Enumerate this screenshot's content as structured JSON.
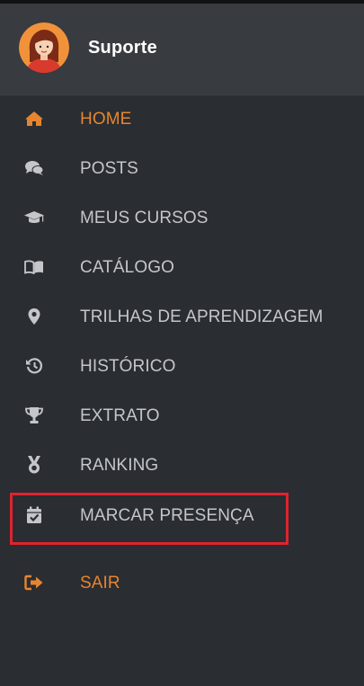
{
  "colors": {
    "background": "#2a2d31",
    "header_background": "#383b40",
    "accent": "#e68531",
    "text": "#c4c6ca",
    "icon": "#c4c6ca",
    "highlight_border": "#e0232e"
  },
  "user": {
    "name": "Suporte",
    "avatar_icon": "user-avatar-woman"
  },
  "menu": {
    "items": [
      {
        "label": "HOME",
        "icon": "home-icon",
        "active": true
      },
      {
        "label": "POSTS",
        "icon": "comments-icon",
        "active": false
      },
      {
        "label": "MEUS CURSOS",
        "icon": "graduation-cap-icon",
        "active": false
      },
      {
        "label": "CATÁLOGO",
        "icon": "book-open-icon",
        "active": false
      },
      {
        "label": "TRILHAS DE APRENDIZAGEM",
        "icon": "map-marker-icon",
        "active": false
      },
      {
        "label": "HISTÓRICO",
        "icon": "history-icon",
        "active": false
      },
      {
        "label": "EXTRATO",
        "icon": "trophy-icon",
        "active": false
      },
      {
        "label": "RANKING",
        "icon": "medal-icon",
        "active": false
      },
      {
        "label": "MARCAR PRESENÇA",
        "icon": "calendar-check-icon",
        "active": false,
        "highlighted": true
      }
    ],
    "exit": {
      "label": "SAIR",
      "icon": "sign-out-icon"
    }
  }
}
